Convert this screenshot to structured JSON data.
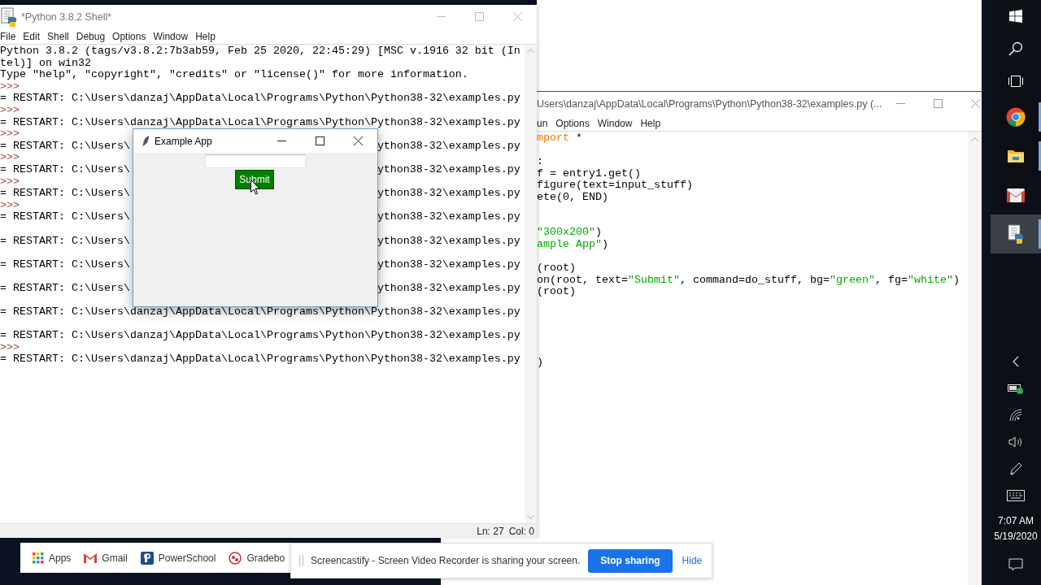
{
  "shell": {
    "title": "*Python 3.8.2 Shell*",
    "menu": [
      "File",
      "Edit",
      "Shell",
      "Debug",
      "Options",
      "Window",
      "Help"
    ],
    "lines": [
      {
        "kind": "output",
        "text": "Python 3.8.2 (tags/v3.8.2:7b3ab59, Feb 25 2020, 22:45:29) [MSC v.1916 32 bit (In"
      },
      {
        "kind": "output",
        "text": "tel)] on win32"
      },
      {
        "kind": "output",
        "text": "Type \"help\", \"copyright\", \"credits\" or \"license()\" for more information."
      },
      {
        "kind": "prompt",
        "text": ">>>"
      },
      {
        "kind": "output",
        "text": "= RESTART: C:\\Users\\danzaj\\AppData\\Local\\Programs\\Python\\Python38-32\\examples.py"
      },
      {
        "kind": "prompt",
        "text": ">>>"
      },
      {
        "kind": "output",
        "text": "= RESTART: C:\\Users\\danzaj\\AppData\\Local\\Programs\\Python\\Python38-32\\examples.py"
      },
      {
        "kind": "prompt",
        "text": ">>>"
      },
      {
        "kind": "split",
        "left": "= RESTART: C:\\Users\\",
        "right": "ython38-32\\examples.py"
      },
      {
        "kind": "prompt",
        "text": ">>>"
      },
      {
        "kind": "split",
        "left": "= RESTART: C:\\Users\\",
        "right": "ython38-32\\examples.py"
      },
      {
        "kind": "prompt",
        "text": ">>>"
      },
      {
        "kind": "split",
        "left": "= RESTART: C:\\Users\\",
        "right": "ython38-32\\examples.py"
      },
      {
        "kind": "prompt",
        "text": ">>>"
      },
      {
        "kind": "split",
        "left": "= RESTART: C:\\Users\\",
        "right": "ython38-32\\examples.py"
      },
      {
        "kind": "blank"
      },
      {
        "kind": "split",
        "left": "= RESTART: C:\\Users\\",
        "right": "ython38-32\\examples.py"
      },
      {
        "kind": "blank"
      },
      {
        "kind": "split",
        "left": "= RESTART: C:\\Users\\",
        "right": "ython38-32\\examples.py"
      },
      {
        "kind": "blank"
      },
      {
        "kind": "split",
        "left": "= RESTART: C:\\Users\\",
        "right": "ython38-32\\examples.py"
      },
      {
        "kind": "blank"
      },
      {
        "kind": "output",
        "text": "= RESTART: C:\\Users\\danzaj\\AppData\\Local\\Programs\\Python\\Python38-32\\examples.py"
      },
      {
        "kind": "blank"
      },
      {
        "kind": "output",
        "text": "= RESTART: C:\\Users\\danzaj\\AppData\\Local\\Programs\\Python\\Python38-32\\examples.py"
      },
      {
        "kind": "prompt",
        "text": ">>>"
      },
      {
        "kind": "output",
        "text": "= RESTART: C:\\Users\\danzaj\\AppData\\Local\\Programs\\Python\\Python38-32\\examples.py"
      }
    ],
    "status": {
      "line": "Ln: 27",
      "col": "Col: 0"
    }
  },
  "example_app": {
    "title": "Example App",
    "button": "Submit"
  },
  "editor": {
    "title": "Users\\danzaj\\AppData\\Local\\Programs\\Python\\Python38-32\\examples.py (...",
    "menu": [
      "un",
      "Options",
      "Window",
      "Help"
    ],
    "lines": [
      {
        "kind": "code",
        "segments": [
          {
            "kind": "keyword",
            "text": "mport"
          },
          {
            "kind": "plain",
            "text": " *"
          }
        ]
      },
      {
        "kind": "blank"
      },
      {
        "kind": "code",
        "segments": [
          {
            "kind": "plain",
            "text": ":"
          }
        ]
      },
      {
        "kind": "code",
        "segments": [
          {
            "kind": "plain",
            "text": "f = entry1.get()"
          }
        ]
      },
      {
        "kind": "code",
        "segments": [
          {
            "kind": "plain",
            "text": "figure(text=input_stuff)"
          }
        ]
      },
      {
        "kind": "code",
        "segments": [
          {
            "kind": "plain",
            "text": "ete(0, END)"
          }
        ]
      },
      {
        "kind": "blank"
      },
      {
        "kind": "blank"
      },
      {
        "kind": "code",
        "segments": [
          {
            "kind": "string",
            "text": "\"300x200\""
          },
          {
            "kind": "plain",
            "text": ")"
          }
        ]
      },
      {
        "kind": "code",
        "segments": [
          {
            "kind": "string",
            "text": "ample App\""
          },
          {
            "kind": "plain",
            "text": ")"
          }
        ]
      },
      {
        "kind": "blank"
      },
      {
        "kind": "code",
        "segments": [
          {
            "kind": "plain",
            "text": "(root)"
          }
        ]
      },
      {
        "kind": "code",
        "segments": [
          {
            "kind": "plain",
            "text": "on(root, text="
          },
          {
            "kind": "string",
            "text": "\"Submit\""
          },
          {
            "kind": "plain",
            "text": ", command=do_stuff, bg="
          },
          {
            "kind": "string",
            "text": "\"green\""
          },
          {
            "kind": "plain",
            "text": ", fg="
          },
          {
            "kind": "string",
            "text": "\"white\""
          },
          {
            "kind": "plain",
            "text": ")"
          }
        ]
      },
      {
        "kind": "code",
        "segments": [
          {
            "kind": "plain",
            "text": "(root)"
          }
        ]
      },
      {
        "kind": "blank"
      },
      {
        "kind": "blank"
      },
      {
        "kind": "blank"
      },
      {
        "kind": "blank"
      },
      {
        "kind": "blank"
      },
      {
        "kind": "code",
        "segments": [
          {
            "kind": "plain",
            "text": ")"
          }
        ]
      }
    ]
  },
  "taskbar": {
    "apps": [
      {
        "kind": "start",
        "selected": false,
        "running": false
      },
      {
        "kind": "search",
        "selected": false,
        "running": false
      },
      {
        "kind": "taskview",
        "selected": false,
        "running": false
      },
      {
        "kind": "browser",
        "selected": false,
        "running": true
      },
      {
        "kind": "folder",
        "selected": false,
        "running": true
      },
      {
        "kind": "mail",
        "selected": false,
        "running": false
      },
      {
        "kind": "script",
        "selected": true,
        "running": true
      }
    ],
    "tray": [
      {
        "kind": "chevron"
      },
      {
        "kind": "battery"
      },
      {
        "kind": "wifi"
      },
      {
        "kind": "speaker"
      },
      {
        "kind": "pen"
      },
      {
        "kind": "keyboard"
      }
    ],
    "time": "7:07 AM",
    "date": "5/19/2020"
  },
  "bookmarks": [
    {
      "kind": "grid",
      "label": "Apps"
    },
    {
      "kind": "mail",
      "label": "Gmail"
    },
    {
      "kind": "square",
      "label": "PowerSchool"
    },
    {
      "kind": "circle",
      "label": "Gradebo"
    }
  ],
  "share_bar": {
    "message": "Screencastify - Screen Video Recorder is sharing your screen.",
    "stop": "Stop sharing",
    "hide": "Hide"
  }
}
